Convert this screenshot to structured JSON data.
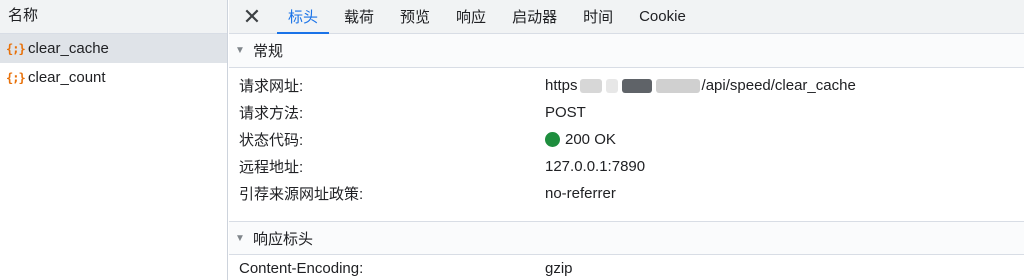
{
  "left": {
    "header": "名称",
    "requests": [
      {
        "icon": "{;}",
        "name": "clear_cache",
        "selected": true
      },
      {
        "icon": "{;}",
        "name": "clear_count",
        "selected": false
      }
    ]
  },
  "tabs": {
    "close": "✕",
    "items": [
      "标头",
      "载荷",
      "预览",
      "响应",
      "启动器",
      "时间",
      "Cookie"
    ],
    "active": "标头"
  },
  "general": {
    "title": "常规",
    "rows": [
      {
        "key": "请求网址:",
        "value_prefix": "https",
        "value_suffix": "/api/speed/clear_cache"
      },
      {
        "key": "请求方法:",
        "value": "POST"
      },
      {
        "key": "状态代码:",
        "value": "200 OK"
      },
      {
        "key": "远程地址:",
        "value": "127.0.0.1:7890"
      },
      {
        "key": "引荐来源网址政策:",
        "value": "no-referrer"
      }
    ]
  },
  "response_headers": {
    "title": "响应标头",
    "rows": [
      {
        "key": "Content-Encoding:",
        "value": "gzip"
      }
    ]
  },
  "colors": {
    "accent": "#1a73e8",
    "status_ok": "#1e8e3e",
    "json_icon": "#e8710a"
  }
}
